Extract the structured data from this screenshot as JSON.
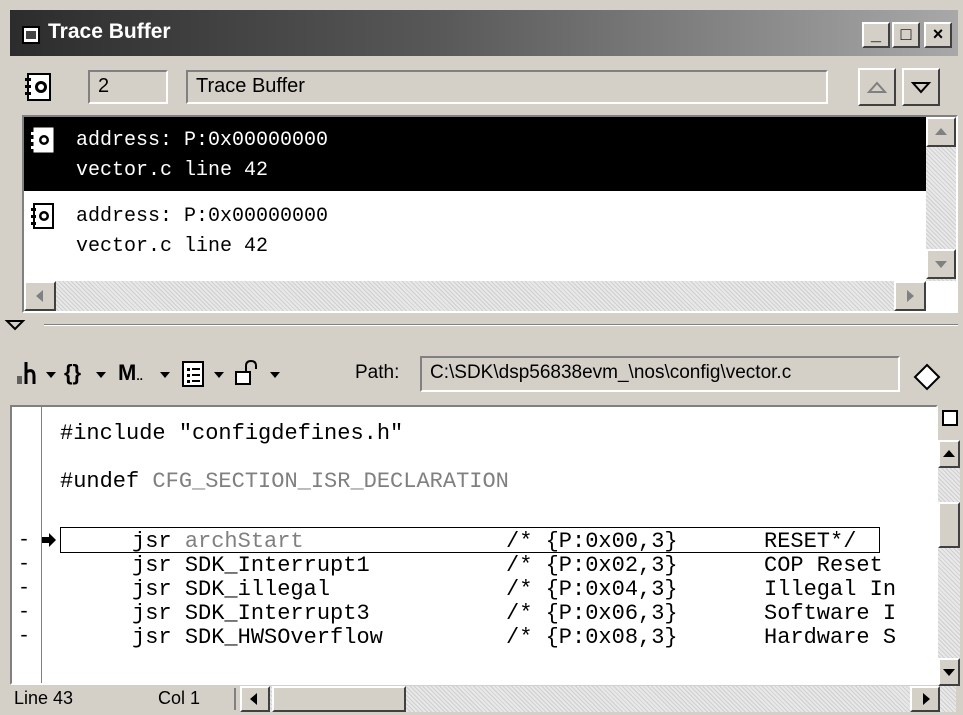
{
  "window": {
    "title": "Trace Buffer",
    "controls": {
      "minimize": "_",
      "maximize": "□",
      "close": "×"
    }
  },
  "header": {
    "index_value": "2",
    "name_value": "Trace Buffer"
  },
  "trace_items": [
    {
      "line1": "address: P:0x00000000",
      "line2": "vector.c line 42"
    },
    {
      "line1": "address: P:0x00000000",
      "line2": "vector.c line 42"
    }
  ],
  "toolbar": {
    "path_label": "Path:",
    "path_value": "C:\\SDK\\dsp56838evm_\\nos\\config\\vector.c"
  },
  "editor": {
    "preamble": [
      {
        "keyword": "#include",
        "rest": " \"configdefines.h\""
      },
      {
        "keyword": "#undef",
        "rest": " CFG_SECTION_ISR_DECLARATION"
      }
    ],
    "rows": [
      {
        "marker": "-",
        "instr": "jsr ",
        "target": "archStart",
        "comment": "/* {P:0x00,3}",
        "desc": "RESET*/"
      },
      {
        "marker": "-",
        "instr": "jsr ",
        "target": "SDK_Interrupt1",
        "comment": "/* {P:0x02,3}",
        "desc": "COP Reset"
      },
      {
        "marker": "-",
        "instr": "jsr ",
        "target": "SDK_illegal",
        "comment": "/* {P:0x04,3}",
        "desc": "Illegal In"
      },
      {
        "marker": "-",
        "instr": "jsr ",
        "target": "SDK_Interrupt3",
        "comment": "/* {P:0x06,3}",
        "desc": "Software I"
      },
      {
        "marker": "-",
        "instr": "jsr ",
        "target": "SDK_HWSOverflow",
        "comment": "/* {P:0x08,3}",
        "desc": "Hardware S"
      }
    ]
  },
  "status": {
    "line": "Line 43",
    "col": "Col 1"
  }
}
